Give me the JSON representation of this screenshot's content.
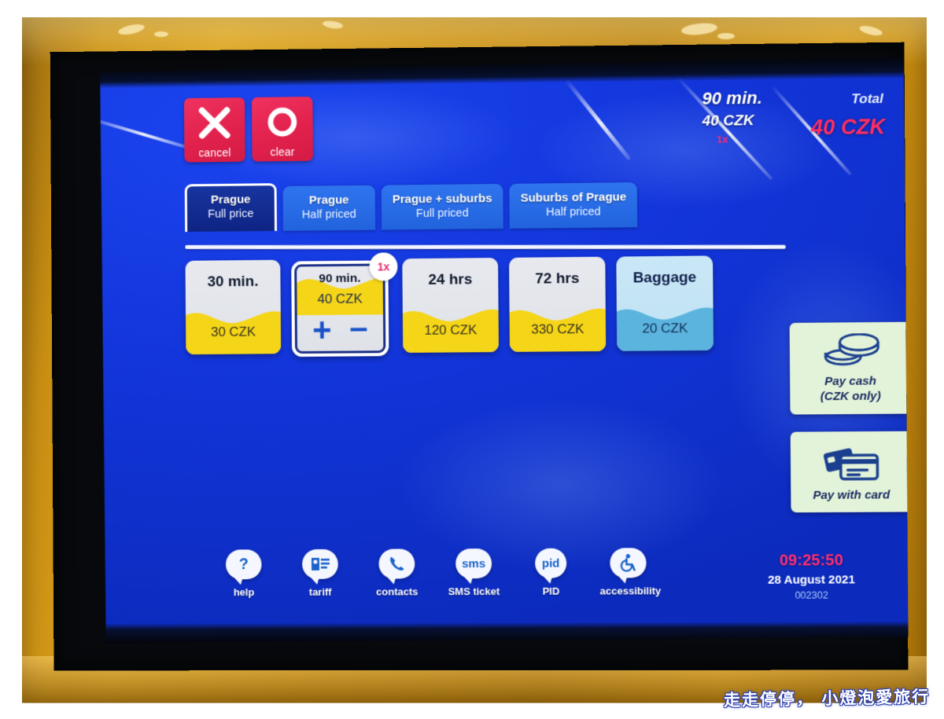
{
  "kiosk": {
    "top_buttons": [
      {
        "name": "cancel",
        "label": "cancel",
        "icon": "cross-icon"
      },
      {
        "name": "clear",
        "label": "clear",
        "icon": "circle-icon"
      }
    ],
    "summary": {
      "ticket_name": "90 min.",
      "ticket_price": "40 CZK",
      "multiplier": "1x",
      "total_label": "Total",
      "total_value": "40 CZK"
    },
    "tabs": [
      {
        "zone": "Prague",
        "price_type": "Full price",
        "active": true
      },
      {
        "zone": "Prague",
        "price_type": "Half priced",
        "active": false
      },
      {
        "zone": "Prague + suburbs",
        "price_type": "Full priced",
        "active": false
      },
      {
        "zone": "Suburbs of Prague",
        "price_type": "Half priced",
        "active": false
      }
    ],
    "tickets": [
      {
        "name": "30 min.",
        "price": "30 CZK",
        "kind": "yellow",
        "selected": false
      },
      {
        "name": "90 min.",
        "price": "40 CZK",
        "kind": "yellow",
        "selected": true,
        "badge": "1x",
        "plus": "+",
        "minus": "–"
      },
      {
        "name": "24 hrs",
        "price": "120 CZK",
        "kind": "yellow",
        "selected": false
      },
      {
        "name": "72 hrs",
        "price": "330 CZK",
        "kind": "yellow",
        "selected": false
      },
      {
        "name": "Baggage",
        "price": "20 CZK",
        "kind": "blue",
        "selected": false
      }
    ],
    "payment": [
      {
        "label": "Pay cash\n(CZK only)",
        "line1": "Pay cash",
        "line2": "(CZK only)",
        "icon": "coins-icon"
      },
      {
        "label": "Pay with card",
        "line1": "Pay with card",
        "line2": "",
        "icon": "credit-card-icon"
      }
    ],
    "toolbar": [
      {
        "label": "help",
        "glyph": "?",
        "icon": "question-mark-icon"
      },
      {
        "label": "tariff",
        "glyph": "",
        "icon": "tariff-document-icon"
      },
      {
        "label": "contacts",
        "glyph": "",
        "icon": "phone-handset-icon"
      },
      {
        "label": "SMS ticket",
        "glyph": "sms",
        "icon": "sms-icon"
      },
      {
        "label": "PID",
        "glyph": "pid",
        "icon": "pid-icon"
      },
      {
        "label": "accessibility",
        "glyph": "",
        "icon": "wheelchair-icon"
      }
    ],
    "status": {
      "time": "09:25:50",
      "date": "28 August 2021",
      "terminal_id": "002302"
    },
    "watermark": "走走停停， 小燈泡愛旅行"
  },
  "colors": {
    "screen_blue": "#1336dc",
    "button_red": "#e2214d",
    "accent_pink": "#ff2e62",
    "ticket_yellow": "#f5d518",
    "baggage_blue": "#5bb4dd",
    "pay_green": "#e3f3d9",
    "bezel_gold": "#c98f13"
  }
}
